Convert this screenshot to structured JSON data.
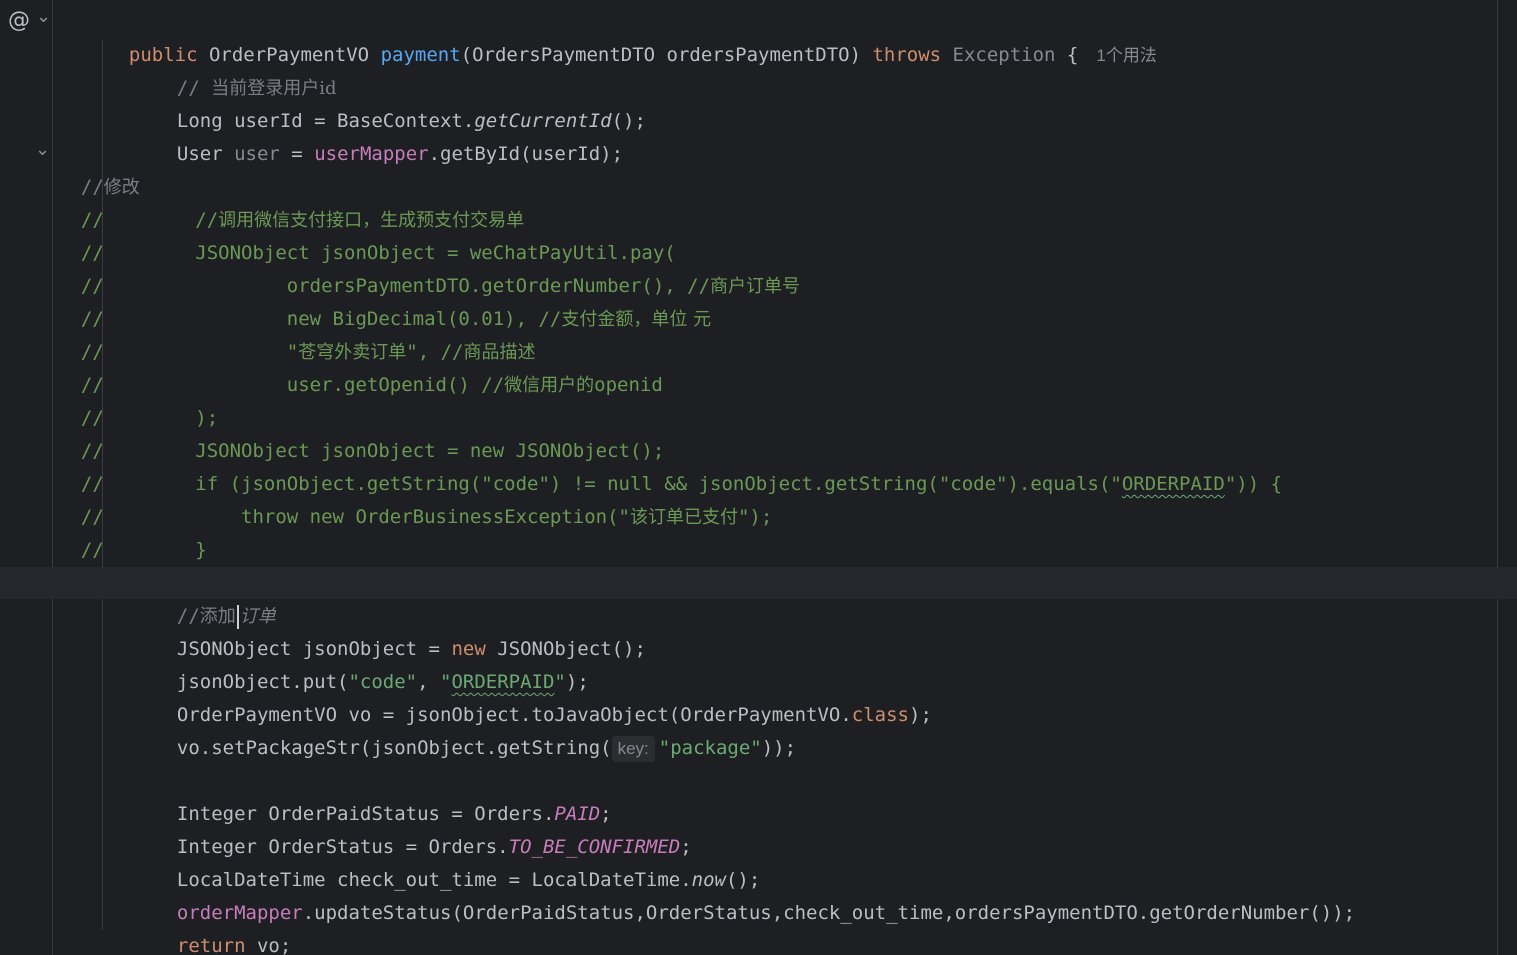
{
  "editor": {
    "usage_hint": "1个用法",
    "param_hint_key": "key:",
    "gutter": {
      "implementation_glyph": "@",
      "fold_glyph": "⌄",
      "fold_glyph_2": "⌄"
    },
    "lines": {
      "l1": {
        "public": "public",
        "type": " OrderPaymentVO ",
        "method": "payment",
        "params": "(OrdersPaymentDTO ordersPaymentDTO) ",
        "throws": "throws",
        "exception": " Exception",
        "brace": " {"
      },
      "l2": {
        "slashes": "// ",
        "text": "当前登录用户id"
      },
      "l3": {
        "a": "Long userId = BaseContext.",
        "b": "getCurrentId",
        "c": "();"
      },
      "l4": {
        "a": "User ",
        "b": "user",
        "c": " = ",
        "d": "userMapper",
        "e": ".getById(userId);"
      },
      "l5": {
        "a": "//",
        "b": "修改"
      },
      "l6": {
        "a": "//",
        "b": "        //",
        "c": "调用微信支付接口，生成预支付交易单"
      },
      "l7": {
        "a": "//",
        "b": "        JSONObject jsonObject = weChatPayUtil.pay("
      },
      "l8": {
        "a": "//",
        "b": "                ordersPaymentDTO.getOrderNumber(), //",
        "c": "商户订单号"
      },
      "l9": {
        "a": "//",
        "b": "                new BigDecimal(0.01), //",
        "c": "支付金额，单位 元"
      },
      "l10": {
        "a": "//",
        "b": "                \"",
        "c": "苍穹外卖订单",
        "d": "\", //",
        "e": "商品描述"
      },
      "l11": {
        "a": "//",
        "b": "                user.getOpenid() //",
        "c": "微信用户的",
        "d": "openid"
      },
      "l12": {
        "a": "//",
        "b": "        );"
      },
      "l13": {
        "a": "//",
        "b": "        JSONObject jsonObject = new JSONObject();"
      },
      "l14": {
        "a": "//",
        "b": "        if (jsonObject.getString(\"code\") != null && jsonObject.getString(\"code\").equals(\"",
        "c": "ORDERPAID",
        "d": "\")) {"
      },
      "l15": {
        "a": "//",
        "b": "            throw new OrderBusinessException(\"",
        "c": "该订单已支付",
        "d": "\");"
      },
      "l16": {
        "a": "//",
        "b": "        }"
      },
      "l17": {
        "a": "//",
        "b": "添加",
        "c": "订单"
      },
      "l18": {
        "a": "JSONObject jsonObject = ",
        "b": "new",
        "c": " JSONObject();"
      },
      "l19": {
        "a": "jsonObject.put(",
        "b": "\"code\"",
        "c": ", ",
        "d": "\"",
        "e": "ORDERPAID",
        "f": "\"",
        "g": ");"
      },
      "l20": {
        "a": "OrderPaymentVO vo = jsonObject.toJavaObject(OrderPaymentVO.",
        "b": "class",
        "c": ");"
      },
      "l21": {
        "a": "vo.setPackageStr(jsonObject.getString(",
        "c": "\"package\"",
        "d": "));"
      },
      "l22": {
        "a": "Integer OrderPaidStatus = Orders.",
        "b": "PAID",
        "c": ";"
      },
      "l23": {
        "a": "Integer OrderStatus = Orders.",
        "b": "TO_BE_CONFIRMED",
        "c": ";"
      },
      "l24": {
        "a": "LocalDateTime check_out_time = LocalDateTime.",
        "b": "now",
        "c": "();"
      },
      "l25": {
        "a": "orderMapper",
        "b": ".updateStatus(OrderPaidStatus,OrderStatus,check_out_time,ordersPaymentDTO.getOrderNumber());"
      },
      "l26": {
        "a": "return",
        "b": " vo;"
      },
      "l27": {
        "a": "}"
      }
    }
  }
}
